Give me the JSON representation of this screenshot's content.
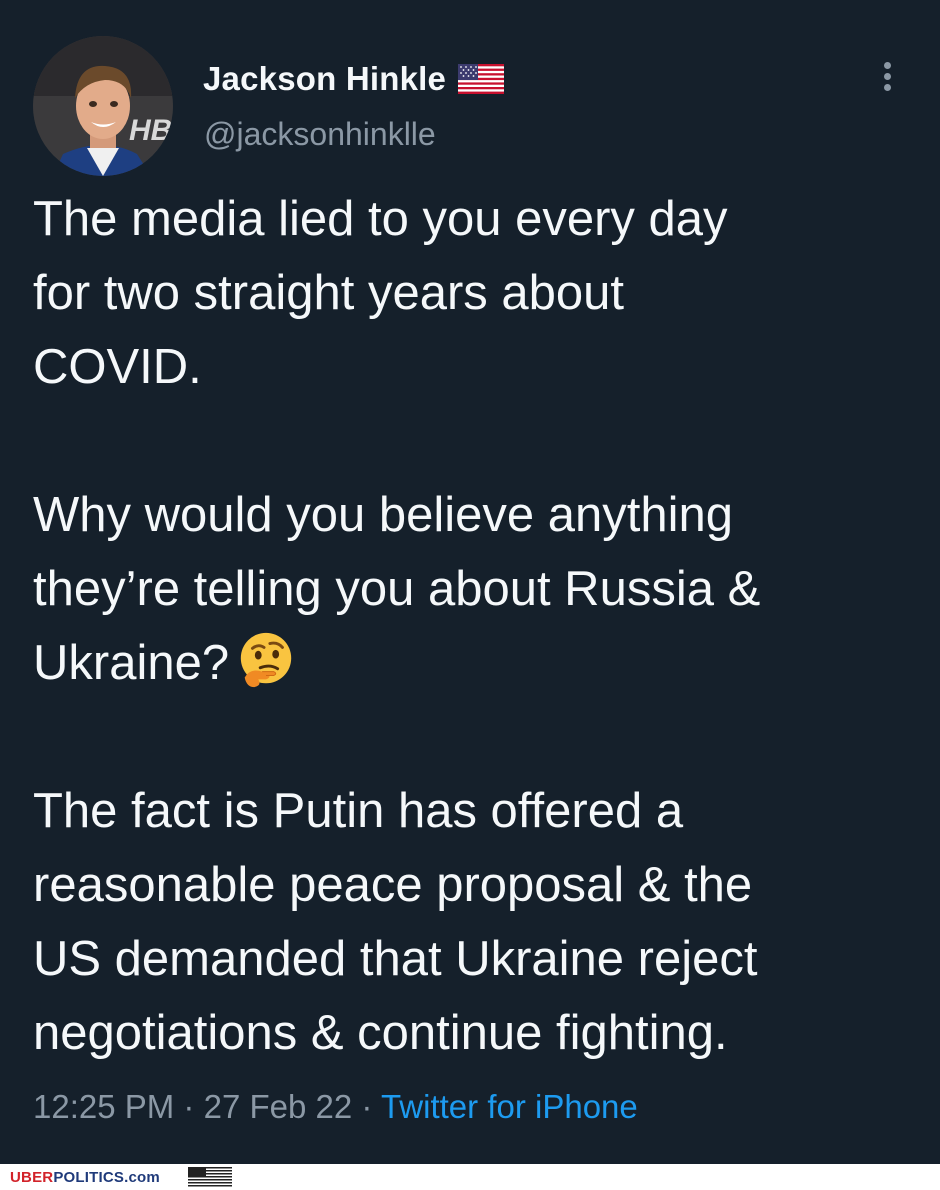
{
  "tweet": {
    "display_name": "Jackson Hinkle",
    "handle": "@jacksonhinklle",
    "avatar_text": "HB",
    "paragraphs": [
      [
        "The media lied to you every day",
        "for two straight years about",
        "COVID."
      ],
      [
        "Why would you believe anything",
        "they’re telling you about Russia &",
        "Ukraine?"
      ],
      [
        "The fact is Putin has offered a",
        "reasonable peace proposal & the",
        "US demanded that Ukraine reject",
        "negotiations & continue fighting."
      ]
    ],
    "emoji": "thinking-face-icon",
    "time": "12:25 PM",
    "separator": "·",
    "date": "27 Feb 22",
    "source": "Twitter for iPhone"
  },
  "footer": {
    "brand_part1": "UBER",
    "brand_part2": "POLITICS.com"
  },
  "colors": {
    "background": "#15202b",
    "text": "#f5f8fa",
    "muted": "#8b98a5",
    "link": "#1d9bf0",
    "brand_red": "#d2232a",
    "brand_blue": "#1f3a7a"
  }
}
